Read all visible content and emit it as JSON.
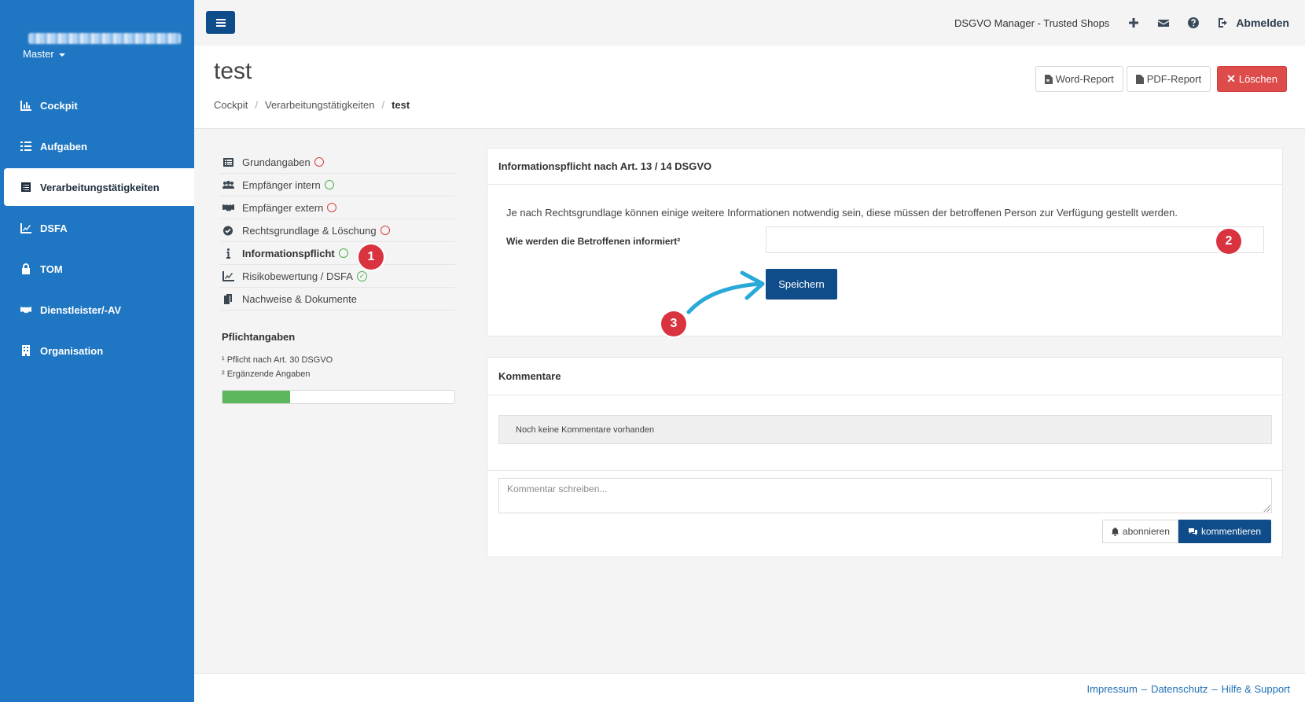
{
  "sidebar": {
    "account_selector": "Master",
    "items": [
      {
        "label": "Cockpit",
        "icon": "chart-bar-icon"
      },
      {
        "label": "Aufgaben",
        "icon": "list-check-icon"
      },
      {
        "label": "Verarbeitungstätigkeiten",
        "icon": "list-alt-icon",
        "active": true
      },
      {
        "label": "DSFA",
        "icon": "line-chart-icon"
      },
      {
        "label": "TOM",
        "icon": "lock-icon"
      },
      {
        "label": "Dienstleister/-AV",
        "icon": "handshake-icon"
      },
      {
        "label": "Organisation",
        "icon": "building-icon"
      }
    ]
  },
  "topbar": {
    "app_name": "DSGVO Manager - Trusted Shops",
    "logout_label": "Abmelden"
  },
  "header": {
    "title": "test",
    "breadcrumb": [
      "Cockpit",
      "Verarbeitungstätigkeiten",
      "test"
    ],
    "word_report_label": "Word-Report",
    "pdf_report_label": "PDF-Report",
    "delete_label": "Löschen"
  },
  "subnav": {
    "items": [
      {
        "label": "Grundangaben",
        "status": "incomplete"
      },
      {
        "label": "Empfänger intern",
        "status": "open"
      },
      {
        "label": "Empfänger extern",
        "status": "incomplete"
      },
      {
        "label": "Rechtsgrundlage & Löschung",
        "status": "incomplete"
      },
      {
        "label": "Informationspflicht",
        "status": "open",
        "active": true
      },
      {
        "label": "Risikobewertung / DSFA",
        "status": "done"
      },
      {
        "label": "Nachweise & Dokumente",
        "status": "none"
      }
    ],
    "pflicht_title": "Pflichtangaben",
    "note_1": "¹ Pflicht nach Art. 30 DSGVO",
    "note_2": "² Ergänzende Angaben",
    "progress_fraction": 0.29
  },
  "info_panel": {
    "title": "Informationspflicht nach Art. 13 / 14 DSGVO",
    "description": "Je nach Rechtsgrundlage können einige weitere Informationen notwendig sein, diese müssen der betroffenen Person zur Verfügung gestellt werden.",
    "field_label": "Wie werden die Betroffenen informiert²",
    "field_value": "",
    "save_label": "Speichern"
  },
  "annotations": {
    "badge_1": "1",
    "badge_2": "2",
    "badge_3": "3"
  },
  "comments_panel": {
    "title": "Kommentare",
    "empty_text": "Noch keine Kommentare vorhanden",
    "placeholder": "Kommentar schreiben...",
    "subscribe_label": "abonnieren",
    "comment_label": "kommentieren"
  },
  "footer": {
    "impressum": "Impressum",
    "datenschutz": "Datenschutz",
    "hilfe": "Hilfe & Support",
    "separator": "–"
  },
  "colors": {
    "sidebar": "#1f76c2",
    "primary": "#0e4c8a",
    "danger": "#dd4b4b",
    "badge": "#d93340",
    "arrow": "#29a9d8",
    "progress": "#5cb85c"
  }
}
